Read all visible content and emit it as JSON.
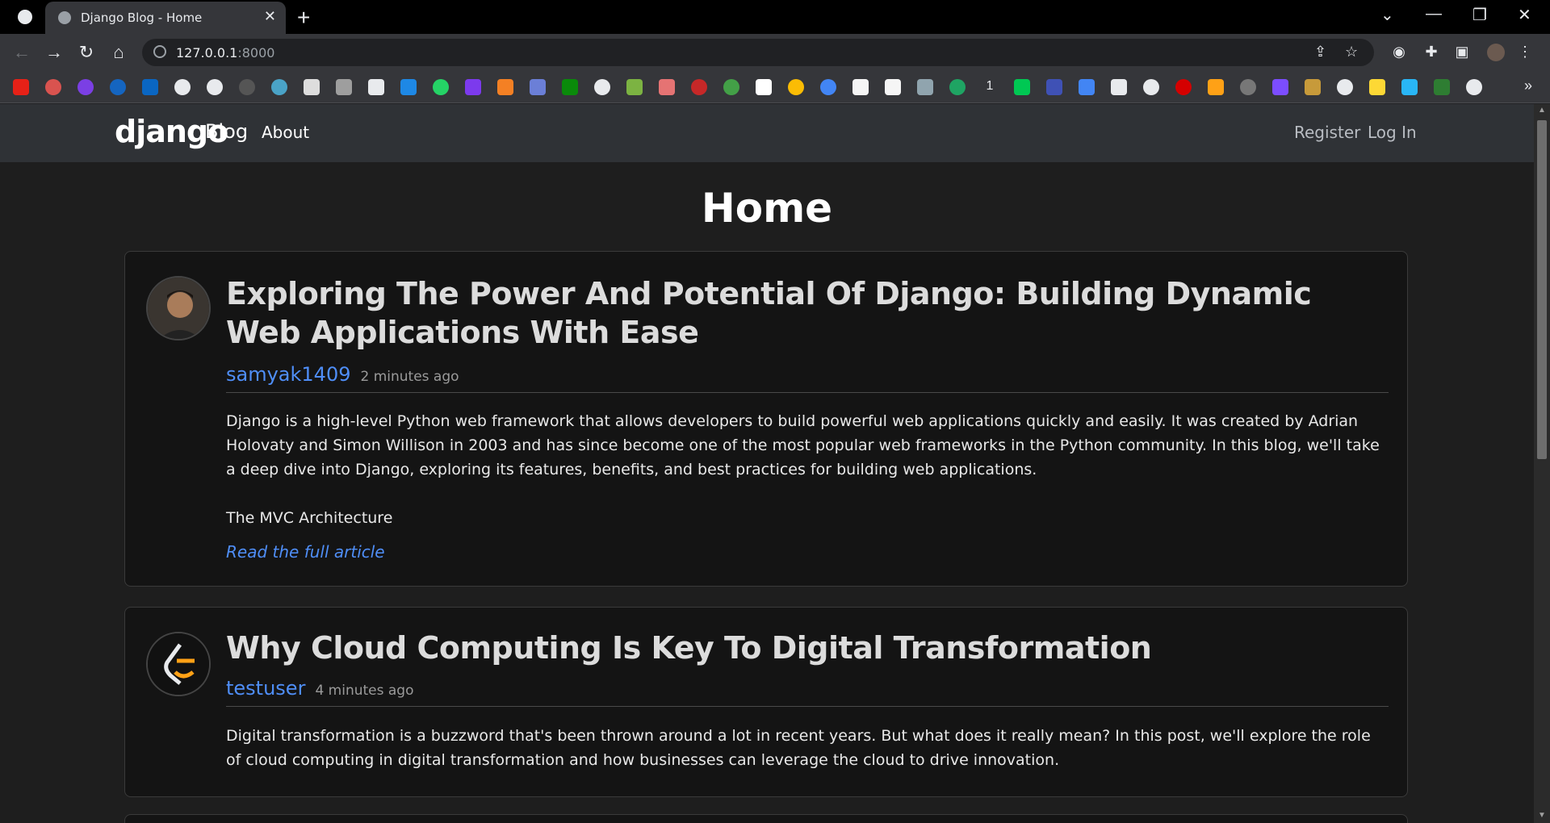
{
  "browser": {
    "tab_title": "Django Blog - Home",
    "url_host": "127.0.0.1",
    "url_port": ":8000"
  },
  "site": {
    "brand": "django",
    "brand_suffix": "Blog",
    "nav_about": "About",
    "nav_register": "Register",
    "nav_login": "Log In",
    "page_title": "Home"
  },
  "posts": [
    {
      "title": "Exploring The Power And Potential Of Django: Building Dynamic Web Applications With Ease",
      "author": "samyak1409",
      "time": "2 minutes ago",
      "paragraph1": "Django is a high-level Python web framework that allows developers to build powerful web applications quickly and easily. It was created by Adrian Holovaty and Simon Willison in 2003 and has since become one of the most popular web frameworks in the Python community. In this blog, we'll take a deep dive into Django, exploring its features, benefits, and best practices for building web applications.",
      "paragraph2": "The MVC Architecture",
      "read_more": "Read the full article"
    },
    {
      "title": "Why Cloud Computing Is Key To Digital Transformation",
      "author": "testuser",
      "time": "4 minutes ago",
      "paragraph1": "Digital transformation is a buzzword that's been thrown around a lot in recent years. But what does it really mean? In this post, we'll explore the role of cloud computing in digital transformation and how businesses can leverage the cloud to drive innovation."
    }
  ],
  "colors": {
    "link": "#4f8ef7",
    "card_bg": "#141414",
    "page_bg": "#1e1e1e",
    "nav_bg": "#2f3236"
  }
}
